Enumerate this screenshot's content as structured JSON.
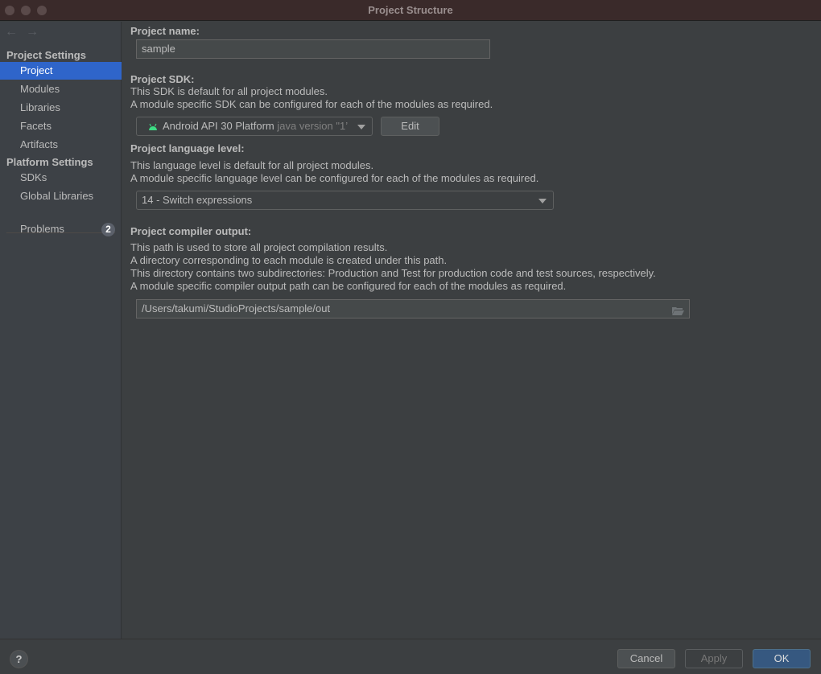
{
  "window": {
    "title": "Project Structure"
  },
  "sidebar": {
    "back_label": "←",
    "forward_label": "→",
    "sections": [
      {
        "title": "Project Settings",
        "items": [
          {
            "label": "Project",
            "selected": true
          },
          {
            "label": "Modules"
          },
          {
            "label": "Libraries"
          },
          {
            "label": "Facets"
          },
          {
            "label": "Artifacts"
          }
        ]
      },
      {
        "title": "Platform Settings",
        "items": [
          {
            "label": "SDKs"
          },
          {
            "label": "Global Libraries"
          }
        ]
      }
    ],
    "problems": {
      "label": "Problems",
      "count": "2"
    }
  },
  "main": {
    "project_name": {
      "label": "Project name:",
      "value": "sample"
    },
    "project_sdk": {
      "label": "Project SDK:",
      "desc1": "This SDK is default for all project modules.",
      "desc2": "A module specific SDK can be configured for each of the modules as required.",
      "selected": "Android API 30 Platform",
      "selected_suffix": "java version \"1’",
      "edit_label": "Edit",
      "accent": "#3ddc84"
    },
    "language_level": {
      "label": "Project language level:",
      "desc1": "This language level is default for all project modules.",
      "desc2": "A module specific language level can be configured for each of the modules as required.",
      "selected": "14 - Switch expressions"
    },
    "compiler_output": {
      "label": "Project compiler output:",
      "desc1": "This path is used to store all project compilation results.",
      "desc2": "A directory corresponding to each module is created under this path.",
      "desc3": "This directory contains two subdirectories: Production and Test for production code and test sources, respectively.",
      "desc4": "A module specific compiler output path can be configured for each of the modules as required.",
      "value": "/Users/takumi/StudioProjects/sample/out"
    }
  },
  "footer": {
    "help_label": "?",
    "cancel_label": "Cancel",
    "apply_label": "Apply",
    "ok_label": "OK"
  }
}
